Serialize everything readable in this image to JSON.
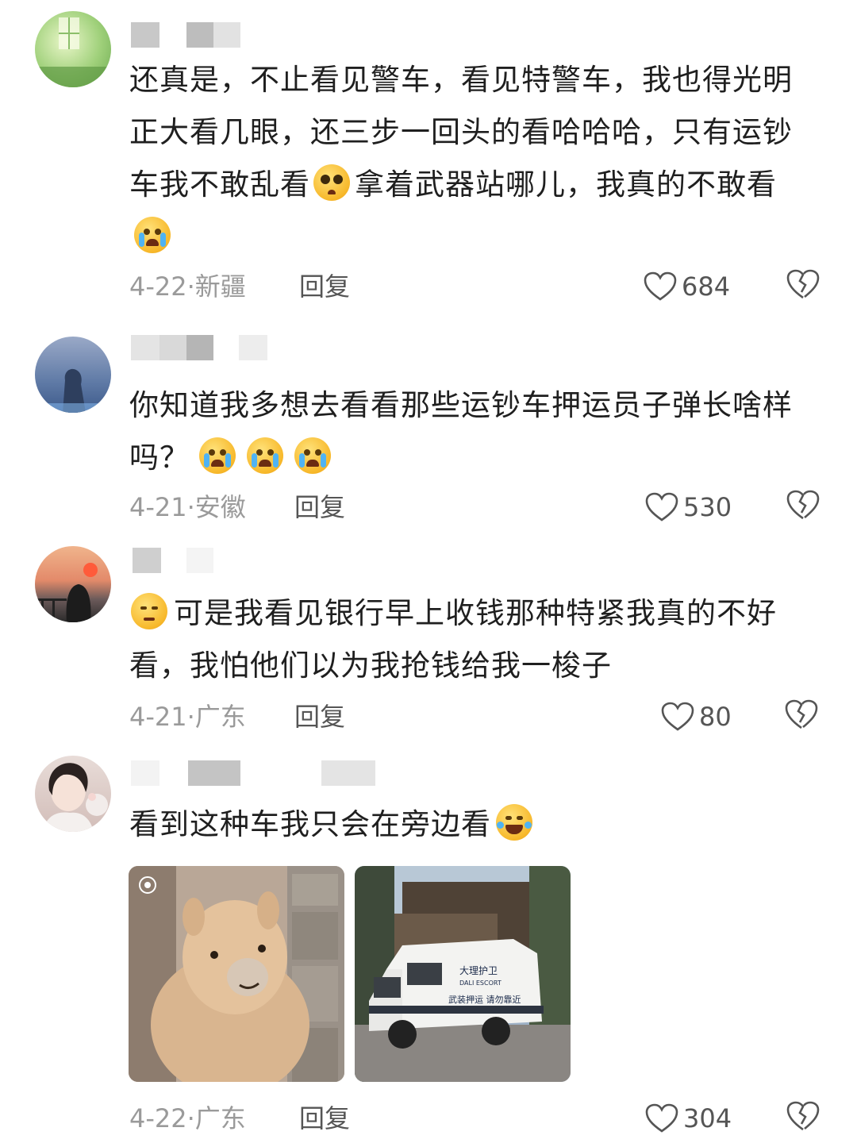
{
  "comments": [
    {
      "text_lines": [
        "还真是，不止看见警车，看见特警车，我也得光明",
        "正大看几眼，还三步一回头的看哈哈哈，只有运钞",
        "拿着武器站哪儿，我真的不敢看"
      ],
      "line3_prefix": "车我不敢乱看",
      "emoji_1": "pleading-face-icon",
      "emoji_2": "loudly-crying-face-icon",
      "date": "4-22",
      "location": "新疆",
      "reply_label": "回复",
      "likes": "684"
    },
    {
      "line1": "你知道我多想去看看那些运钞车押运员子弹长啥样",
      "line2": "吗？",
      "emoji": "loudly-crying-face-icon",
      "emoji_count": 3,
      "date": "4-21",
      "location": "安徽",
      "reply_label": "回复",
      "likes": "530"
    },
    {
      "line1": "可是我看见银行早上收钱那种特紧我真的不好",
      "line2": "看，我怕他们以为我抢钱给我一梭子",
      "emoji": "unamused-face-icon",
      "date": "4-21",
      "location": "广东",
      "reply_label": "回复",
      "likes": "80"
    },
    {
      "line1": "看到这种车我只会在旁边看",
      "emoji": "tears-of-joy-face-icon",
      "photo_1": "alpaca-photo",
      "photo_2": "escort-van-photo",
      "van_text_1": "大理护卫",
      "van_text_2": "DALI ESCORT",
      "van_text_3": "武装押运 请勿靠近",
      "date": "4-22",
      "location": "广东",
      "reply_label": "回复",
      "likes": "304"
    }
  ],
  "separator": "·",
  "colors": {
    "text": "#1f1f1f",
    "meta": "#9a9a9a",
    "action": "#555555",
    "background": "#ffffff"
  }
}
